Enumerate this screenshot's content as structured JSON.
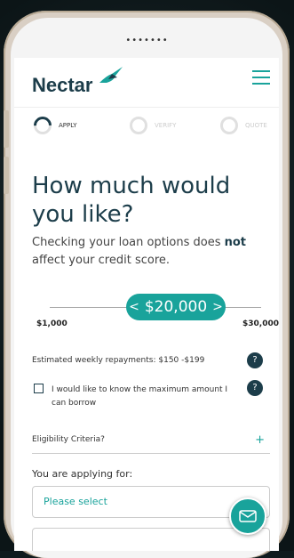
{
  "phone": {
    "speaker_dots": "•••••••"
  },
  "brand": {
    "logo_text": "Nectar"
  },
  "steps": [
    {
      "label": "APPLY"
    },
    {
      "label": "VERIFY"
    },
    {
      "label": "QUOTE"
    }
  ],
  "main": {
    "title": "How much would you like?",
    "subtitle_pre": "Checking your loan options does",
    "subtitle_bold": "not",
    "subtitle_post": "affect your credit score."
  },
  "slider": {
    "value_label": "$20,000",
    "min_label": "$1,000",
    "max_label": "$30,000",
    "value_fraction": 0.655
  },
  "estimate": {
    "text": "Estimated weekly repayments: $150 -$199",
    "help": "?"
  },
  "checkbox": {
    "label": "I would like to know the maximum amount I can borrow",
    "checked": false,
    "help": "?"
  },
  "eligibility": {
    "label": "Eligibility Criteria?",
    "toggle": "+"
  },
  "applying": {
    "label": "You are applying for:",
    "select_value": "Please select"
  },
  "colors": {
    "accent": "#19a39b",
    "navy": "#1c3d4a"
  }
}
